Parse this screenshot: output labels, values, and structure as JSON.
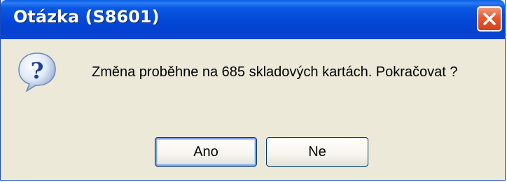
{
  "dialog": {
    "title": "Otázka (S8601)",
    "message": "Změna proběhne na 685 skladových kartách. Pokračovat ?",
    "icon": "question-icon",
    "buttons": {
      "yes_label": "Ano",
      "no_label": "Ne"
    }
  },
  "colors": {
    "titlebar": "#0446d6",
    "dialog_background": "#ece9d8",
    "close_button": "#e35a2c"
  }
}
